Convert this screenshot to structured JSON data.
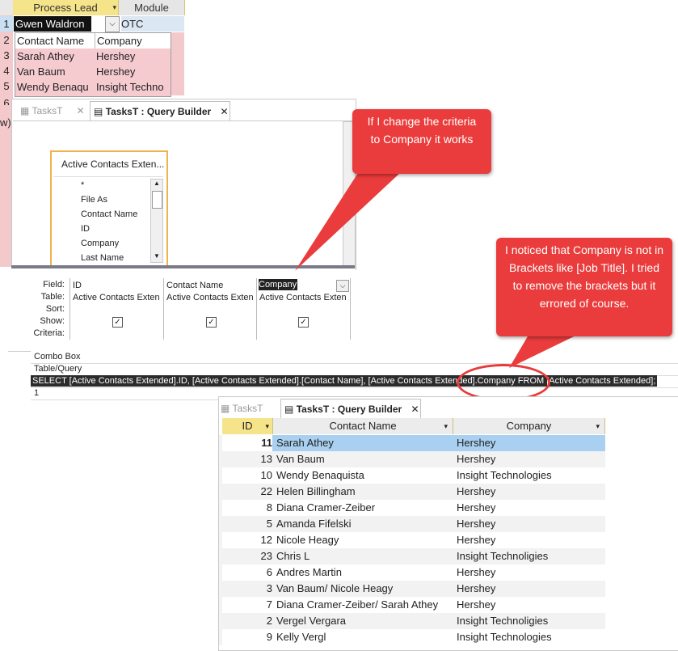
{
  "top_grid": {
    "headers": [
      "Process Lead",
      "Module"
    ],
    "row_numbers": [
      "1",
      "2",
      "3",
      "4",
      "5",
      "6"
    ],
    "current_value": "Gwen Waldron",
    "module_value": "OTC",
    "dropdown_rows": [
      {
        "contact": "Contact Name",
        "company": "Company"
      },
      {
        "contact": "Sarah Athey",
        "company": "Hershey"
      },
      {
        "contact": "Van Baum",
        "company": "Hershey"
      },
      {
        "contact": "Wendy Benaqu",
        "company": "Insight Techno"
      }
    ],
    "side_text": "w)"
  },
  "query_builder_1": {
    "tabs": [
      "TasksT",
      "TasksT : Query Builder"
    ],
    "table_title": "Active Contacts Exten...",
    "fields": [
      "*",
      "File As",
      "Contact Name",
      "ID",
      "Company",
      "Last Name"
    ]
  },
  "query_grid": {
    "row_labels": [
      "Field:",
      "Table:",
      "Sort:",
      "Show:",
      "Criteria:"
    ],
    "columns": [
      {
        "field": "ID",
        "table": "Active Contacts Exten"
      },
      {
        "field": "Contact Name",
        "table": "Active Contacts Exten"
      },
      {
        "field": "Company",
        "table": "Active Contacts Exten"
      }
    ]
  },
  "property_sheet": {
    "row1": "Combo Box",
    "row2": "Table/Query",
    "sql": "SELECT [Active Contacts Extended].ID, [Active Contacts Extended].[Contact Name], [Active Contacts Extended].Company FROM [Active Contacts Extended];",
    "row4": "1"
  },
  "callouts": {
    "top": "If I change the criteria to Company it works",
    "right": "I noticed that Company is not in Brackets like [Job Title]. I tried to remove the brackets but it errored of course."
  },
  "result_sheet": {
    "tabs": [
      "TasksT",
      "TasksT : Query Builder"
    ],
    "headers": [
      "ID",
      "Contact Name",
      "Company"
    ],
    "rows": [
      {
        "id": "11",
        "name": "Sarah Athey",
        "company": "Hershey"
      },
      {
        "id": "13",
        "name": "Van Baum",
        "company": "Hershey"
      },
      {
        "id": "10",
        "name": "Wendy Benaquista",
        "company": "Insight Technologies"
      },
      {
        "id": "22",
        "name": "Helen Billingham",
        "company": "Hershey"
      },
      {
        "id": "8",
        "name": "Diana Cramer-Zeiber",
        "company": "Hershey"
      },
      {
        "id": "5",
        "name": "Amanda Fifelski",
        "company": "Hershey"
      },
      {
        "id": "12",
        "name": "Nicole Heagy",
        "company": "Hershey"
      },
      {
        "id": "23",
        "name": "Chris L",
        "company": "Insight Technoligies"
      },
      {
        "id": "6",
        "name": "Andres Martin",
        "company": "Hershey"
      },
      {
        "id": "3",
        "name": "Van Baum/ Nicole Heagy",
        "company": "Hershey"
      },
      {
        "id": "7",
        "name": "Diana Cramer-Zeiber/ Sarah Athey",
        "company": "Hershey"
      },
      {
        "id": "2",
        "name": "Vergel Vergara",
        "company": "Insight Technoligies"
      },
      {
        "id": "9",
        "name": "Kelly Vergl",
        "company": "Insight Technologies"
      }
    ]
  },
  "colors": {
    "accent_header": "#f6e48a",
    "selected_row": "#a9d0f0",
    "callout": "#ea3c3c",
    "pink": "#f3c9cc"
  }
}
